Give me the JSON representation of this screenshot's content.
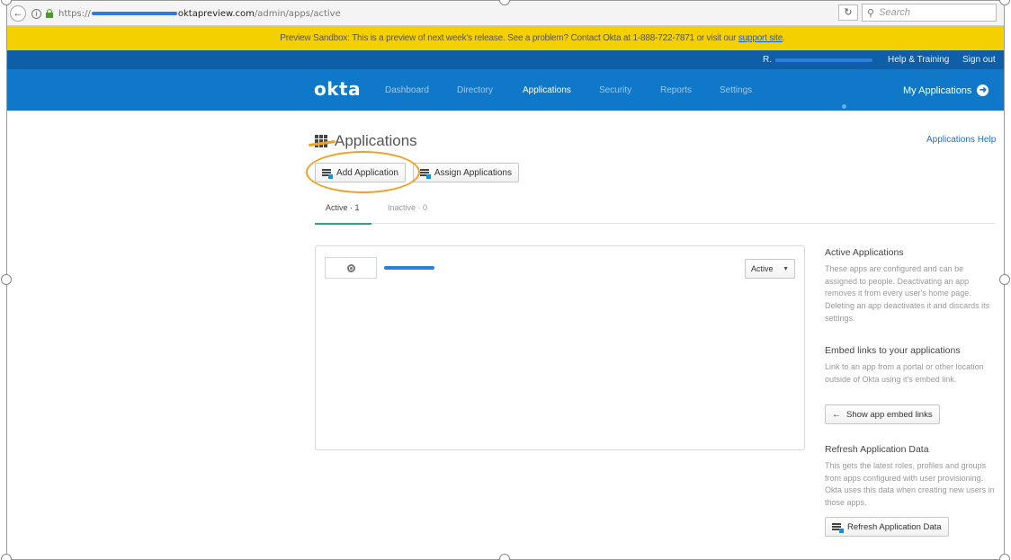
{
  "browser": {
    "url_prefix": "https://",
    "url_host": "oktapreview.com",
    "url_path": "/admin/apps/active",
    "search_placeholder": "Search"
  },
  "banner": {
    "text": "Preview Sandbox: This is a preview of next week's release. See a problem? Contact Okta at 1-888-722-7871 or visit our",
    "link_label": "support site",
    "link_suffix": ".",
    "color": "#f5d000"
  },
  "header": {
    "user_initial": "R.",
    "help_label": "Help & Training",
    "signout_label": "Sign out",
    "logo": "okta",
    "nav": [
      {
        "label": "Dashboard",
        "active": false
      },
      {
        "label": "Directory",
        "active": false
      },
      {
        "label": "Applications",
        "active": true
      },
      {
        "label": "Security",
        "active": false
      },
      {
        "label": "Reports",
        "active": false
      },
      {
        "label": "Settings",
        "active": false
      }
    ],
    "my_apps_label": "My Applications",
    "brand_color": "#0f78c8",
    "top_strip_color": "#0e5ea8"
  },
  "page": {
    "title": "Applications",
    "help_link": "Applications Help",
    "add_button": "Add Application",
    "assign_button": "Assign Applications",
    "tabs": [
      {
        "label": "Active · 1",
        "active": true
      },
      {
        "label": "Inactive · 0",
        "active": false
      }
    ],
    "tab_accent": "#2ba877"
  },
  "apps": [
    {
      "status": "Active"
    }
  ],
  "sidebar": {
    "active_title": "Active Applications",
    "active_text": "These apps are configured and can be assigned to people. Deactivating an app removes it from every user's home page. Deleting an app deactivates it and discards its settings.",
    "embed_title": "Embed links to your applications",
    "embed_text": "Link to an app from a portal or other location outside of Okta using it's embed link.",
    "embed_button": "Show app embed links",
    "refresh_title": "Refresh Application Data",
    "refresh_text": "This gets the latest roles, profiles and groups from apps configured with user provisioning. Okta uses this data when creating new users in those apps.",
    "refresh_button": "Refresh Application Data"
  },
  "icons": [
    "back-arrow-icon",
    "info-icon",
    "lock-icon",
    "reload-icon",
    "search-icon",
    "arrow-right-circle-icon",
    "grid-icon",
    "app-add-icon",
    "app-assign-icon",
    "target-icon",
    "caret-down-icon",
    "arrow-left-icon",
    "refresh-app-icon"
  ]
}
